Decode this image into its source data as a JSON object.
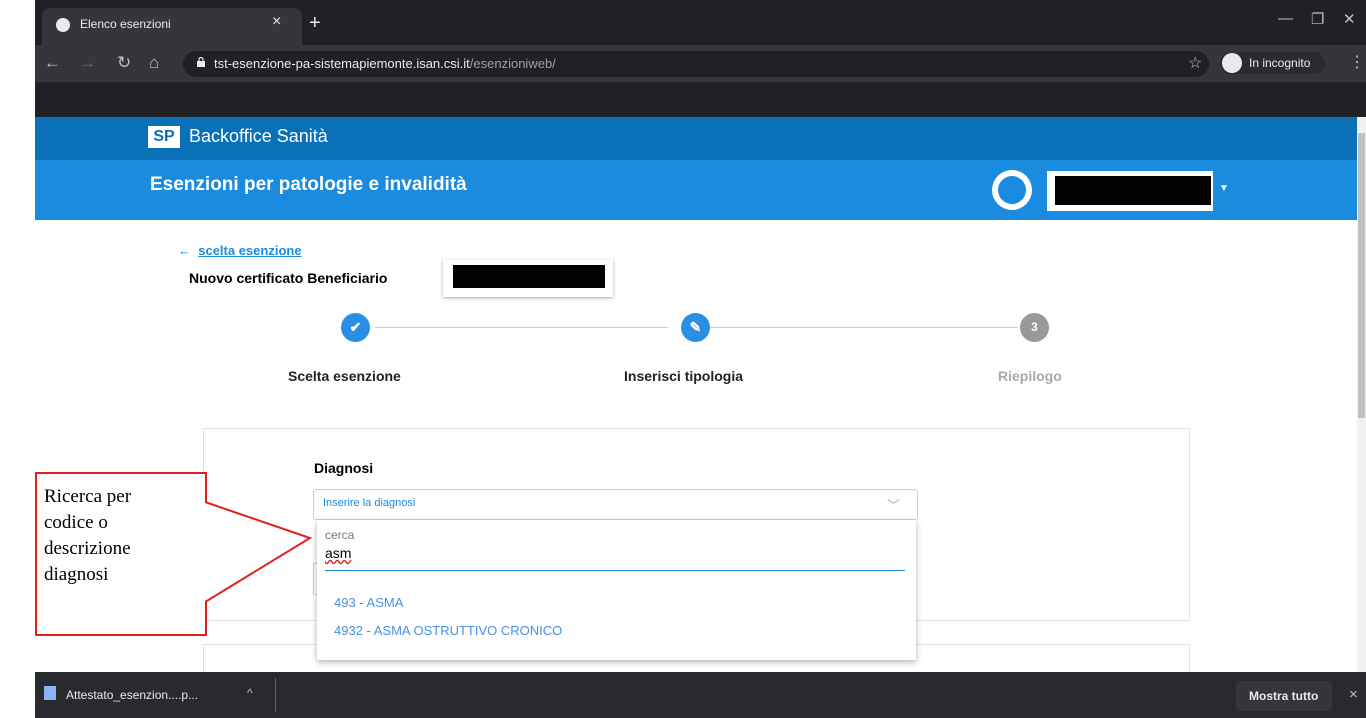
{
  "browser": {
    "tab_title": "Elenco esenzioni",
    "tab_close": "×",
    "new_tab": "+",
    "url_host": "tst-esenzione-pa-sistemapiemonte.isan.csi.it",
    "url_path": "/esenzioniweb/",
    "incognito_label": "In incognito",
    "icons": [
      "globe-icon",
      "back-icon",
      "forward-icon",
      "reload-icon",
      "home-icon",
      "lock-icon",
      "star-icon",
      "incognito-icon",
      "kebab-icon",
      "minimize-icon",
      "restore-icon",
      "close-icon"
    ]
  },
  "app": {
    "logo": "SP",
    "name": "Backoffice Sanità",
    "section_title": "Esenzioni per patologie e invalidità",
    "accent": "#1b8be0",
    "header_dark": "#0a70b8"
  },
  "content": {
    "back_arrow": "←",
    "back_link": "scelta esenzione",
    "page_title": "Nuovo certificato Beneficiario",
    "steps": [
      {
        "label": "Scelta esenzione",
        "symbol": "✔",
        "state": "done"
      },
      {
        "label": "Inserisci tipologia",
        "symbol": "✎",
        "state": "active"
      },
      {
        "label": "Riepilogo",
        "symbol": "3",
        "state": "pending"
      }
    ],
    "diagnosi": {
      "label": "Diagnosi",
      "placeholder": "Inserire la diagnosi",
      "search_label": "cerca",
      "search_value": "asm",
      "options": [
        "493 - ASMA",
        "4932 - ASMA OSTRUTTIVO CRONICO"
      ]
    }
  },
  "annotation": {
    "text_lines": [
      "Ricerca per",
      "codice o",
      "descrizione",
      "diagnosi"
    ],
    "color": "#e02020"
  },
  "downloads": {
    "file_name": "Attestato_esenzion....p...",
    "caret": "^",
    "show_all": "Mostra tutto",
    "close": "×"
  }
}
